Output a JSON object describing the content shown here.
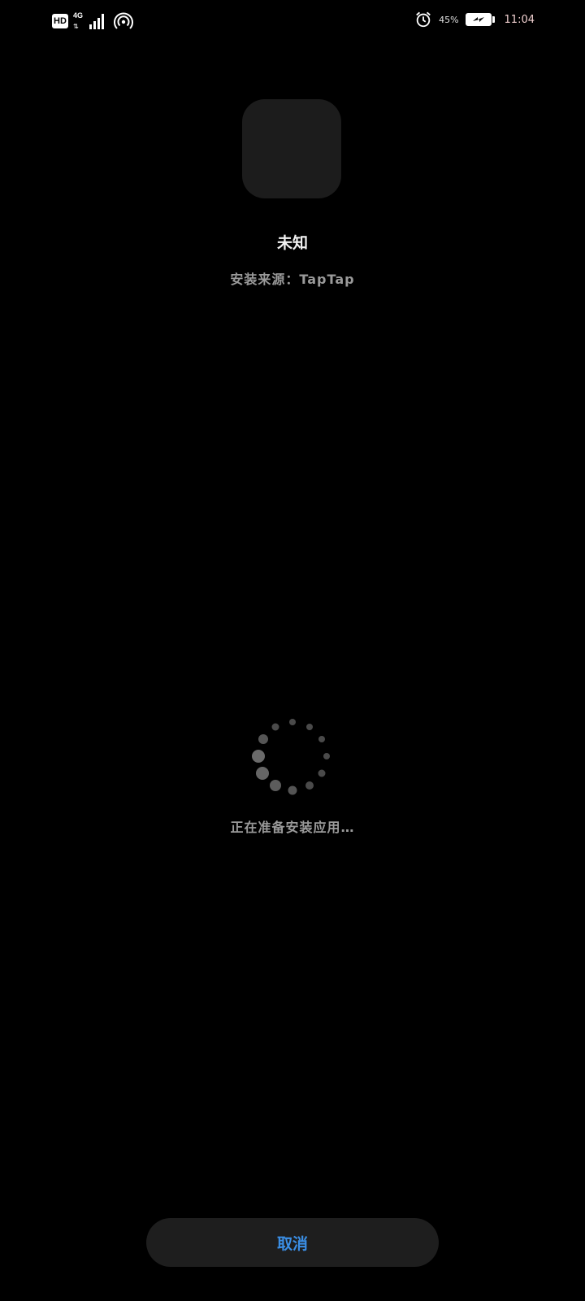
{
  "status_bar": {
    "hd_label": "HD",
    "network_type": "4G",
    "battery_percent": "45%",
    "time": "11:04",
    "icons": [
      "hd-icon",
      "signal-icon",
      "hotspot-icon",
      "alarm-icon",
      "battery-charging-icon"
    ]
  },
  "app": {
    "name": "未知",
    "install_source": "安装来源：TapTap"
  },
  "progress": {
    "status_text": "正在准备安装应用…",
    "icon": "loading-spinner-icon"
  },
  "actions": {
    "cancel_label": "取消",
    "accent_color": "#3b8fe6"
  }
}
